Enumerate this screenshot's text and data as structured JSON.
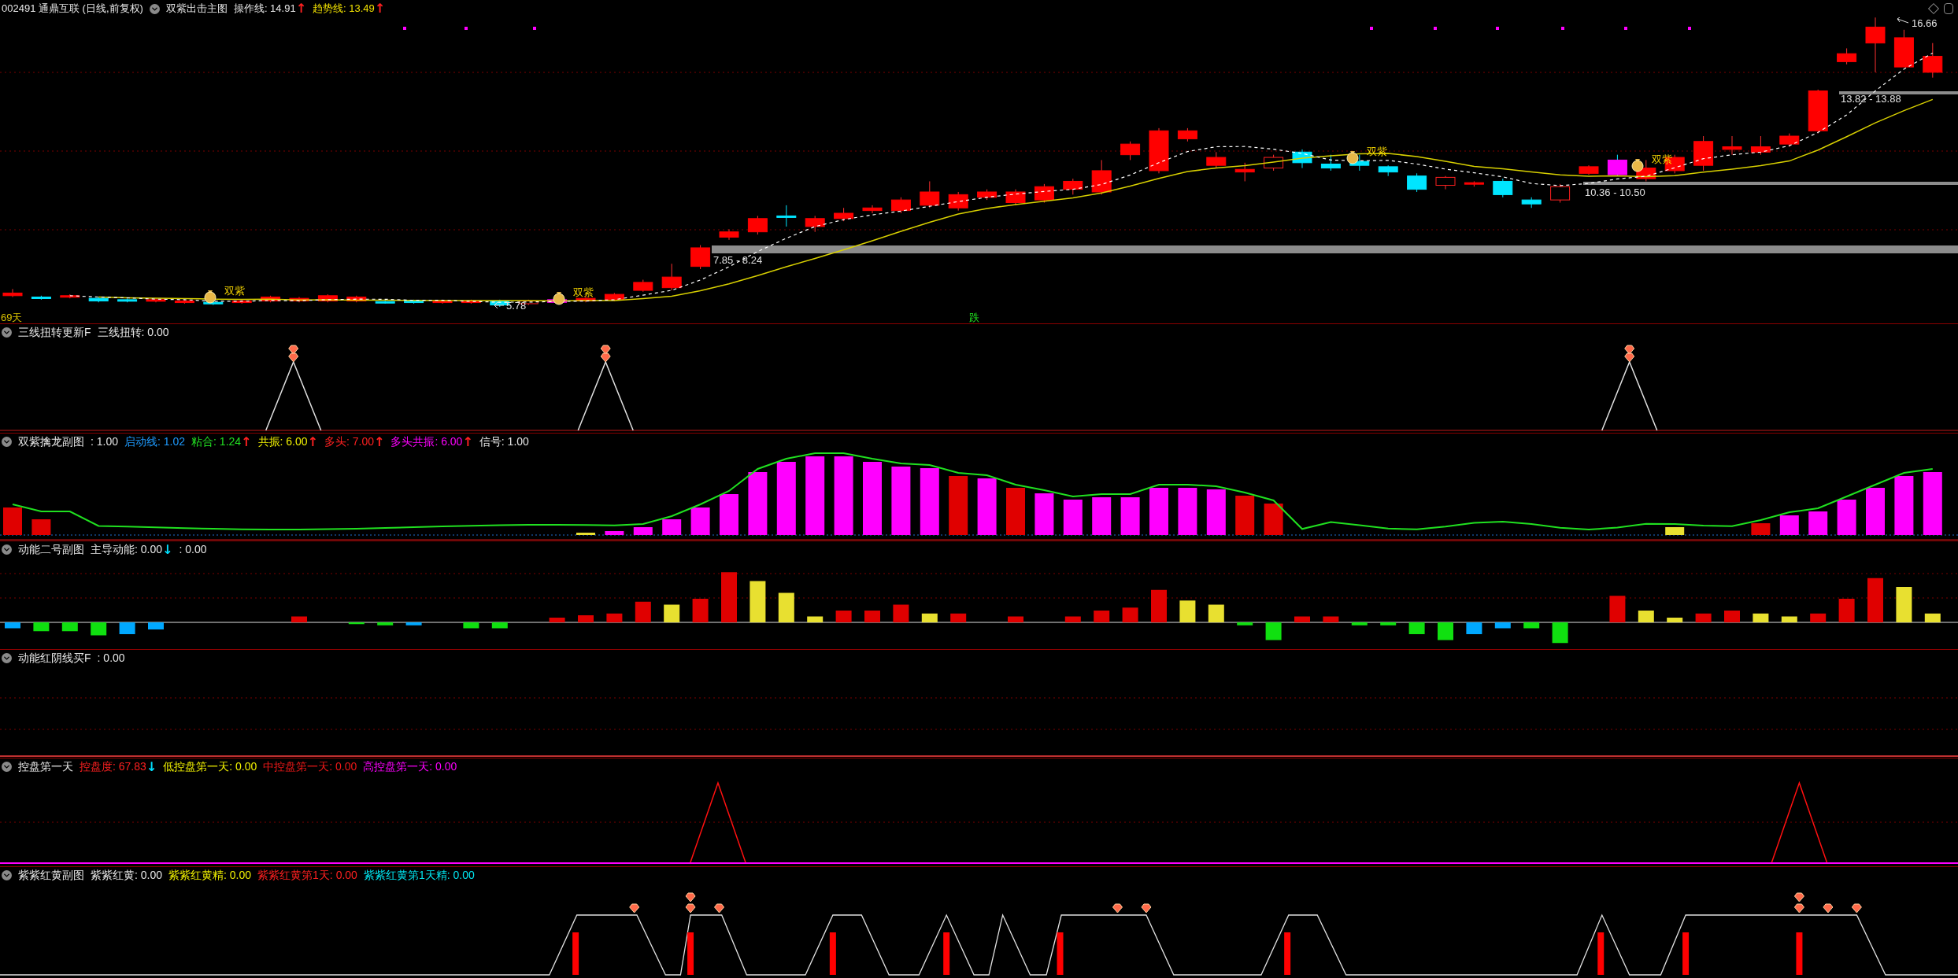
{
  "main": {
    "ticker": "002491 通鼎互联 (日线,前复权)",
    "title": "双紫出击主图",
    "items": [
      {
        "text": "操作线: 14.91",
        "color": "#e6e6e6",
        "arrow": {
          "text": "↑",
          "color": "#ff2020"
        }
      },
      {
        "text": "趋势线: 13.49",
        "color": "#f0e000",
        "arrow": {
          "text": "↑",
          "color": "#ff2020"
        }
      }
    ],
    "price_ranges": [
      "7.85 - 8.24",
      "10.36 - 10.50",
      "13.82 - 13.88"
    ],
    "high_label": "16.66",
    "low_label": "5.78",
    "signal_labels": [
      "双紫",
      "双紫",
      "双紫",
      "双紫"
    ],
    "day_count": "69天",
    "fall_marker": "跌"
  },
  "panels": [
    {
      "kind": "peaks",
      "title": "三线扭转更新F",
      "items": [
        {
          "text": "三线扭转: 0.00",
          "color": "#e6e6e6"
        }
      ]
    },
    {
      "kind": "columns",
      "title": "双紫擒龙副图",
      "items": [
        {
          "text": ": 1.00",
          "color": "#e6e6e6"
        },
        {
          "text": "启动线: 1.02",
          "color": "#1e9bff"
        },
        {
          "text": "粘合: 1.24",
          "color": "#22e022",
          "arrow": {
            "text": "↑",
            "color": "#ff2020"
          }
        },
        {
          "text": "共振: 6.00",
          "color": "#f0f000",
          "arrow": {
            "text": "↑",
            "color": "#ff2020"
          }
        },
        {
          "text": "多头: 7.00",
          "color": "#ff2020",
          "arrow": {
            "text": "↑",
            "color": "#ff2020"
          }
        },
        {
          "text": "多头共振: 6.00",
          "color": "#ff00ff",
          "arrow": {
            "text": "↑",
            "color": "#ff2020"
          }
        },
        {
          "text": "信号: 1.00",
          "color": "#e6e6e6"
        }
      ]
    },
    {
      "kind": "histogram",
      "title": "动能二号副图",
      "items": [
        {
          "text": "主导动能: 0.00",
          "color": "#e6e6e6",
          "arrow": {
            "text": "↓",
            "color": "#00e0ff"
          }
        },
        {
          "text": ": 0.00",
          "color": "#e6e6e6"
        }
      ]
    },
    {
      "kind": "empty",
      "title": "动能红阴线买F",
      "items": [
        {
          "text": ": 0.00",
          "color": "#e6e6e6"
        }
      ]
    },
    {
      "kind": "control",
      "title": "控盘第一天",
      "items": [
        {
          "text": "控盘度: 67.83",
          "color": "#ff2020",
          "arrow": {
            "text": "↓",
            "color": "#00e0ff"
          }
        },
        {
          "text": "低控盘第一天: 0.00",
          "color": "#f0f000"
        },
        {
          "text": "中控盘第一天: 0.00",
          "color": "#f01818"
        },
        {
          "text": "高控盘第一天: 0.00",
          "color": "#ff00ff"
        }
      ]
    },
    {
      "kind": "plateaus",
      "title": "紫紫红黄副图",
      "items": [
        {
          "text": "紫紫红黄: 0.00",
          "color": "#e6e6e6"
        },
        {
          "text": "紫紫红黄精: 0.00",
          "color": "#f0f000"
        },
        {
          "text": "紫紫红黄第1天: 0.00",
          "color": "#ff2020"
        },
        {
          "text": "紫紫红黄第1天精: 0.00",
          "color": "#00e6f0"
        }
      ]
    }
  ]
}
